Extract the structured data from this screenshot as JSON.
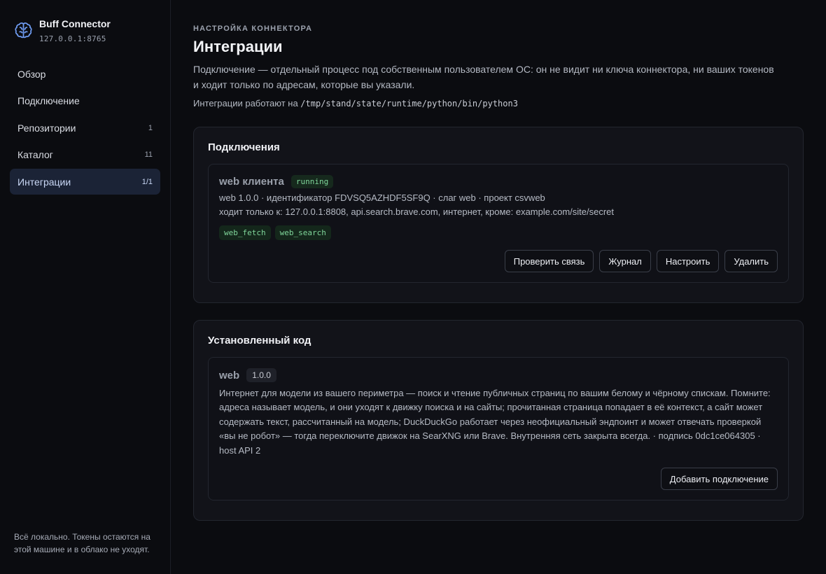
{
  "brand": {
    "title": "Buff Connector",
    "address": "127.0.0.1:8765"
  },
  "nav": {
    "items": [
      {
        "label": "Обзор",
        "count": ""
      },
      {
        "label": "Подключение",
        "count": ""
      },
      {
        "label": "Репозитории",
        "count": "1"
      },
      {
        "label": "Каталог",
        "count": "11"
      },
      {
        "label": "Интеграции",
        "count": "1/1",
        "active": true
      }
    ]
  },
  "sidebar_footer": "Всё локально. Токены остаются на этой машине и в облако не уходят.",
  "header": {
    "eyebrow": "НАСТРОЙКА КОННЕКТОРА",
    "title": "Интеграции",
    "lead": "Подключение — отдельный процесс под собственным пользователем ОС: он не видит ни ключа коннектора, ни ваших токенов и ходит только по адресам, которые вы указали.",
    "runtime_label": "Интеграции работают на",
    "runtime_path": "/tmp/stand/state/runtime/python/bin/python3"
  },
  "connections": {
    "title": "Подключения",
    "item": {
      "name": "web клиента",
      "status": "running",
      "meta_line1": "web 1.0.0 · идентификатор FDVSQ5AZHDF5SF9Q · слаг web · проект csvweb",
      "meta_line2": "ходит только к: 127.0.0.1:8808, api.search.brave.com, интернет, кроме: example.com/site/secret",
      "tools": [
        "web_fetch",
        "web_search"
      ],
      "buttons": {
        "check": "Проверить связь",
        "log": "Журнал",
        "configure": "Настроить",
        "delete": "Удалить"
      }
    }
  },
  "installed": {
    "title": "Установленный код",
    "item": {
      "name": "web",
      "version": "1.0.0",
      "description": "Интернет для модели из вашего периметра — поиск и чтение публичных страниц по вашим белому и чёрному спискам. Помните: адреса называет модель, и они уходят к движку поиска и на сайты; прочитанная страница попадает в её контекст, а сайт может содержать текст, рассчитанный на модель; DuckDuckGo работает через неофициальный эндпоинт и может отвечать проверкой «вы не робот» — тогда переключите движок на SearXNG или Brave. Внутренняя сеть закрыта всегда. · подпись 0dc1ce064305 · host API 2",
      "add_button": "Добавить подключение"
    }
  },
  "colors": {
    "background": "#0b0c10",
    "card": "#121319",
    "active_nav": "#1b2336",
    "status_green": "#7fd59a",
    "brand_icon": "#6f9cf2"
  }
}
